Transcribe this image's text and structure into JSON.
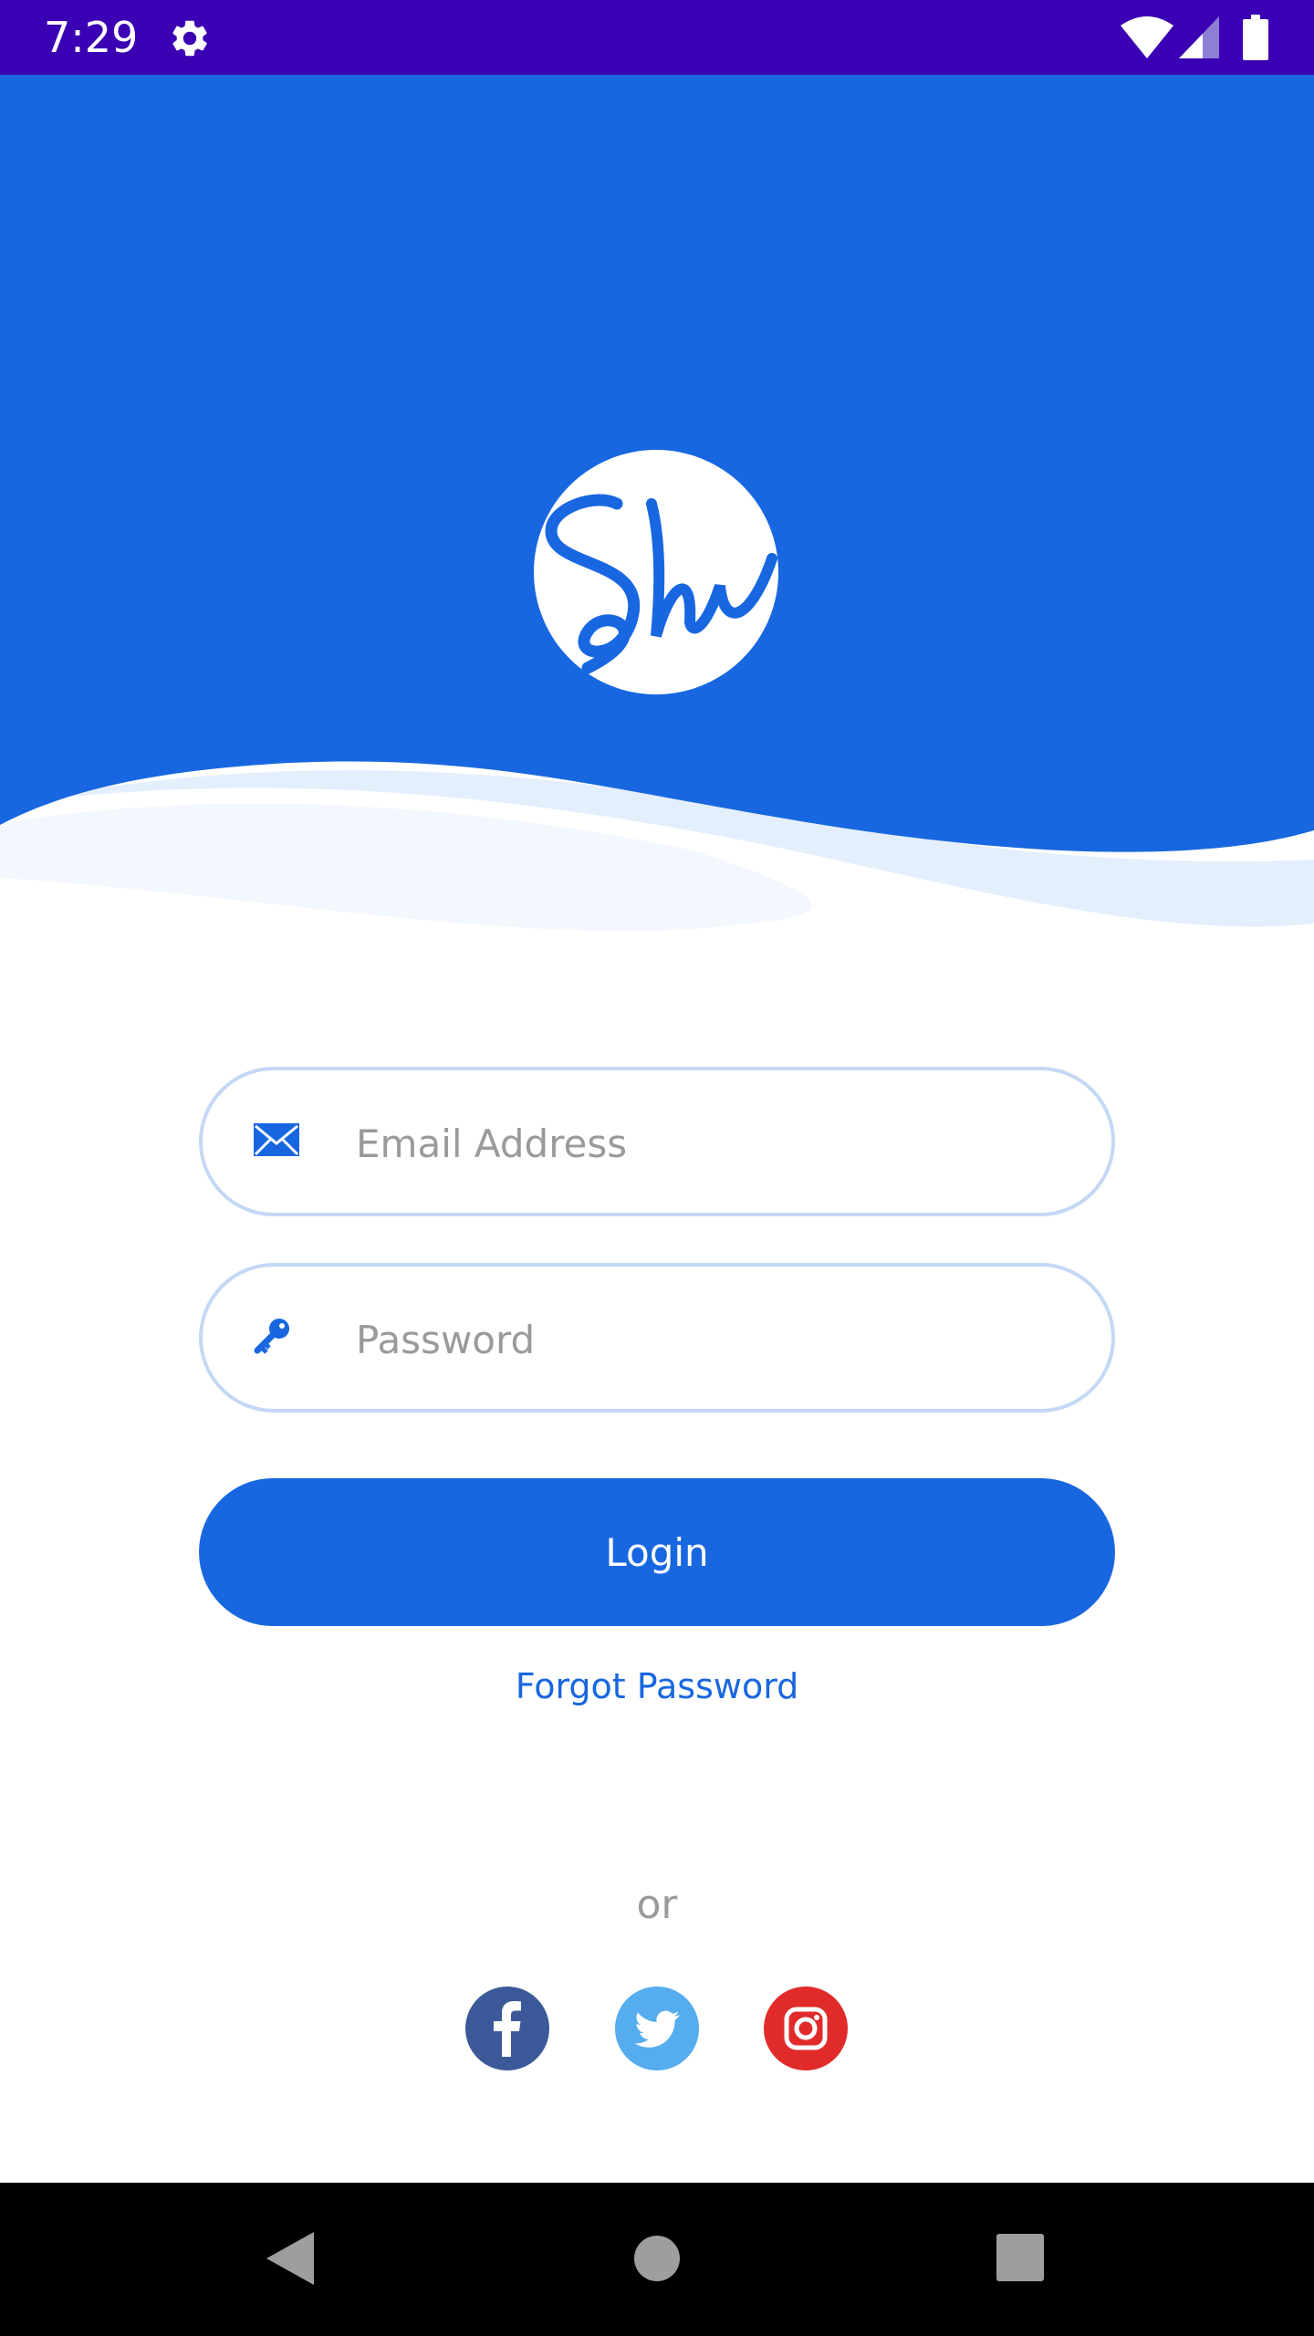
{
  "status_bar": {
    "time": "7:29",
    "icons": [
      "gear-icon",
      "wifi-icon",
      "signal-icon",
      "battery-icon"
    ]
  },
  "logo": {
    "text": "Sh"
  },
  "login_form": {
    "email": {
      "placeholder": "Email Address",
      "value": "",
      "icon": "envelope-icon"
    },
    "password": {
      "placeholder": "Password",
      "value": "",
      "icon": "key-icon"
    },
    "login_label": "Login",
    "forgot_label": "Forgot Password"
  },
  "divider_label": "or",
  "social": [
    {
      "name": "facebook",
      "icon": "facebook-icon",
      "color": "#3b5998"
    },
    {
      "name": "twitter",
      "icon": "twitter-icon",
      "color": "#55acee"
    },
    {
      "name": "instagram",
      "icon": "instagram-icon",
      "color": "#e12b2b"
    }
  ],
  "nav_bar": {
    "icons": [
      "back-icon",
      "home-icon",
      "recents-icon"
    ]
  },
  "colors": {
    "status_bar": "#3b00b3",
    "primary": "#1867e0",
    "wave_light": "#e3effc",
    "field_border": "#c4d8f5",
    "placeholder": "#9a9a9a"
  }
}
